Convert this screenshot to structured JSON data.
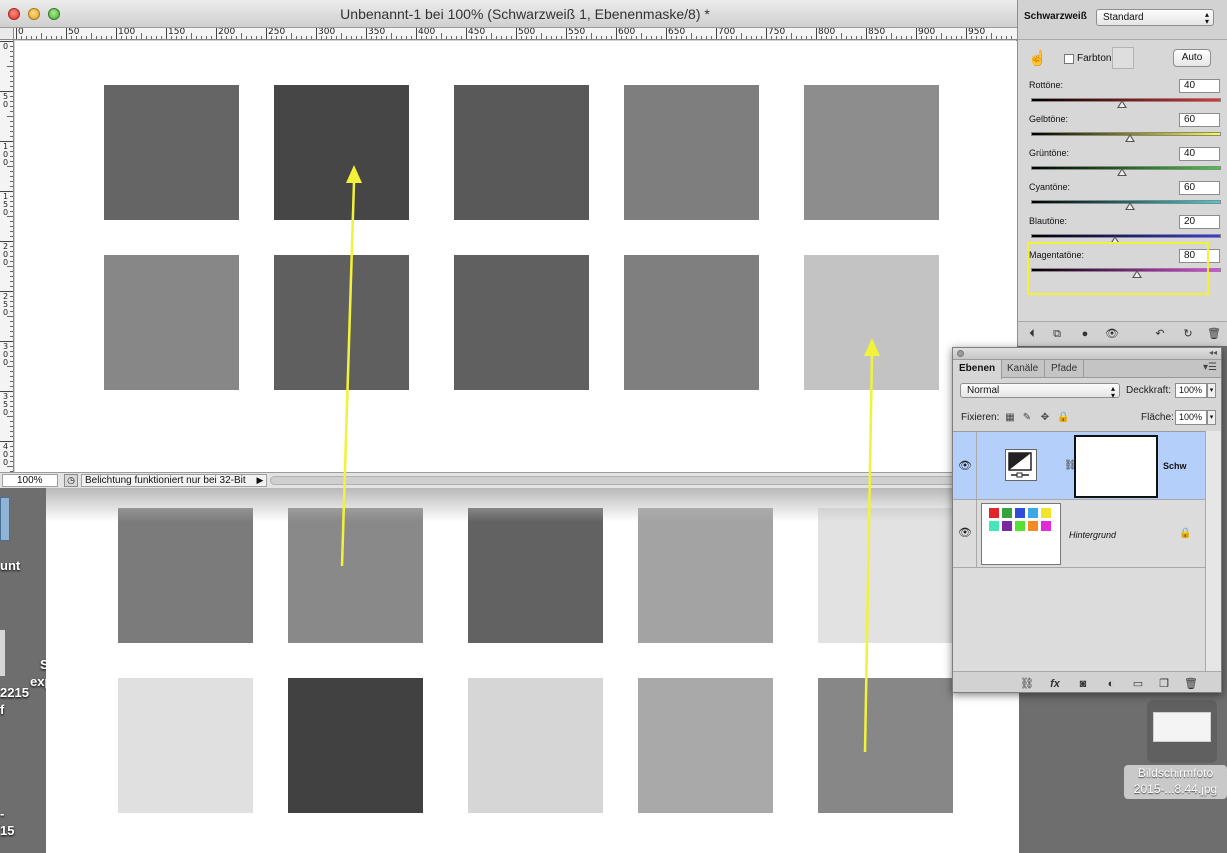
{
  "window": {
    "title": "Unbenannt-1 bei 100% (Schwarzweiß 1, Ebenenmaske/8) *",
    "zoom": "100%",
    "status_text": "Belichtung funktioniert nur bei 32-Bit"
  },
  "ruler": {
    "h_labels": [
      "0",
      "50",
      "100",
      "150",
      "200",
      "250",
      "300",
      "350",
      "400",
      "450",
      "500",
      "550",
      "600",
      "650",
      "700",
      "750",
      "800",
      "850",
      "900",
      "950"
    ],
    "v_labels": [
      "0",
      "5 0",
      "1 0 0",
      "1 5 0",
      "2 0 0",
      "2 5 0",
      "3 0 0",
      "3 5 0",
      "4 0 0"
    ]
  },
  "canvas": {
    "top_row_colors": [
      "#656565",
      "#464646",
      "#595959",
      "#7e7e7e",
      "#8d8d8d"
    ],
    "bottom_row_colors": [
      "#878787",
      "#5f5f5f",
      "#606060",
      "#7f7f7f",
      "#c3c3c3"
    ],
    "arrow_color": "#f2f23a"
  },
  "background_image": {
    "top_row_colors": [
      "#7b7b7b",
      "#898989",
      "#626262",
      "#a3a3a3",
      "#e2e2e2"
    ],
    "bottom_row_colors": [
      "#e0e0e0",
      "#414141",
      "#d6d6d6",
      "#a9a9a9",
      "#878787"
    ]
  },
  "properties": {
    "panel_label": "Schwarzweiß",
    "preset": "Standard",
    "farbton_label": "Farbton",
    "auto_label": "Auto",
    "sliders": [
      {
        "label": "Rottöne:",
        "value": "40",
        "gradient": "linear-gradient(to right,#000,#ff2a2a)"
      },
      {
        "label": "Gelbtöne:",
        "value": "60",
        "gradient": "linear-gradient(to right,#000,#ffff3a)"
      },
      {
        "label": "Grüntöne:",
        "value": "40",
        "gradient": "linear-gradient(to right,#000,#3ad13a)"
      },
      {
        "label": "Cyantöne:",
        "value": "60",
        "gradient": "linear-gradient(to right,#000,#35d6d6)"
      },
      {
        "label": "Blautöne:",
        "value": "20",
        "gradient": "linear-gradient(to right,#000,#3a3aff)"
      },
      {
        "label": "Magentatöne:",
        "value": "80",
        "gradient": "linear-gradient(to right,#000,#ff38ff)"
      }
    ]
  },
  "layers": {
    "tabs": [
      "Ebenen",
      "Kanäle",
      "Pfade"
    ],
    "blend_mode": "Normal",
    "opacity_label": "Deckkraft:",
    "opacity_value": "100%",
    "lock_label": "Fixieren:",
    "fill_label": "Fläche:",
    "fill_value": "100%",
    "items": [
      {
        "name": "Schw"
      },
      {
        "name": "Hintergrund"
      }
    ],
    "swatch_colors": [
      "#e0262a",
      "#37a33f",
      "#2f4bd8",
      "#3aa9e6",
      "#f2e32b",
      "#45e6b9",
      "#7a2aa0",
      "#56e032",
      "#f28c22",
      "#e22ad9"
    ]
  },
  "desktop": {
    "labels": [
      "unt",
      "S",
      "exp",
      "2215",
      "f",
      "-",
      "15"
    ],
    "file_icon_label_1": "Bildschirmfoto",
    "file_icon_label_2": "2015-...8.44.jpg"
  }
}
